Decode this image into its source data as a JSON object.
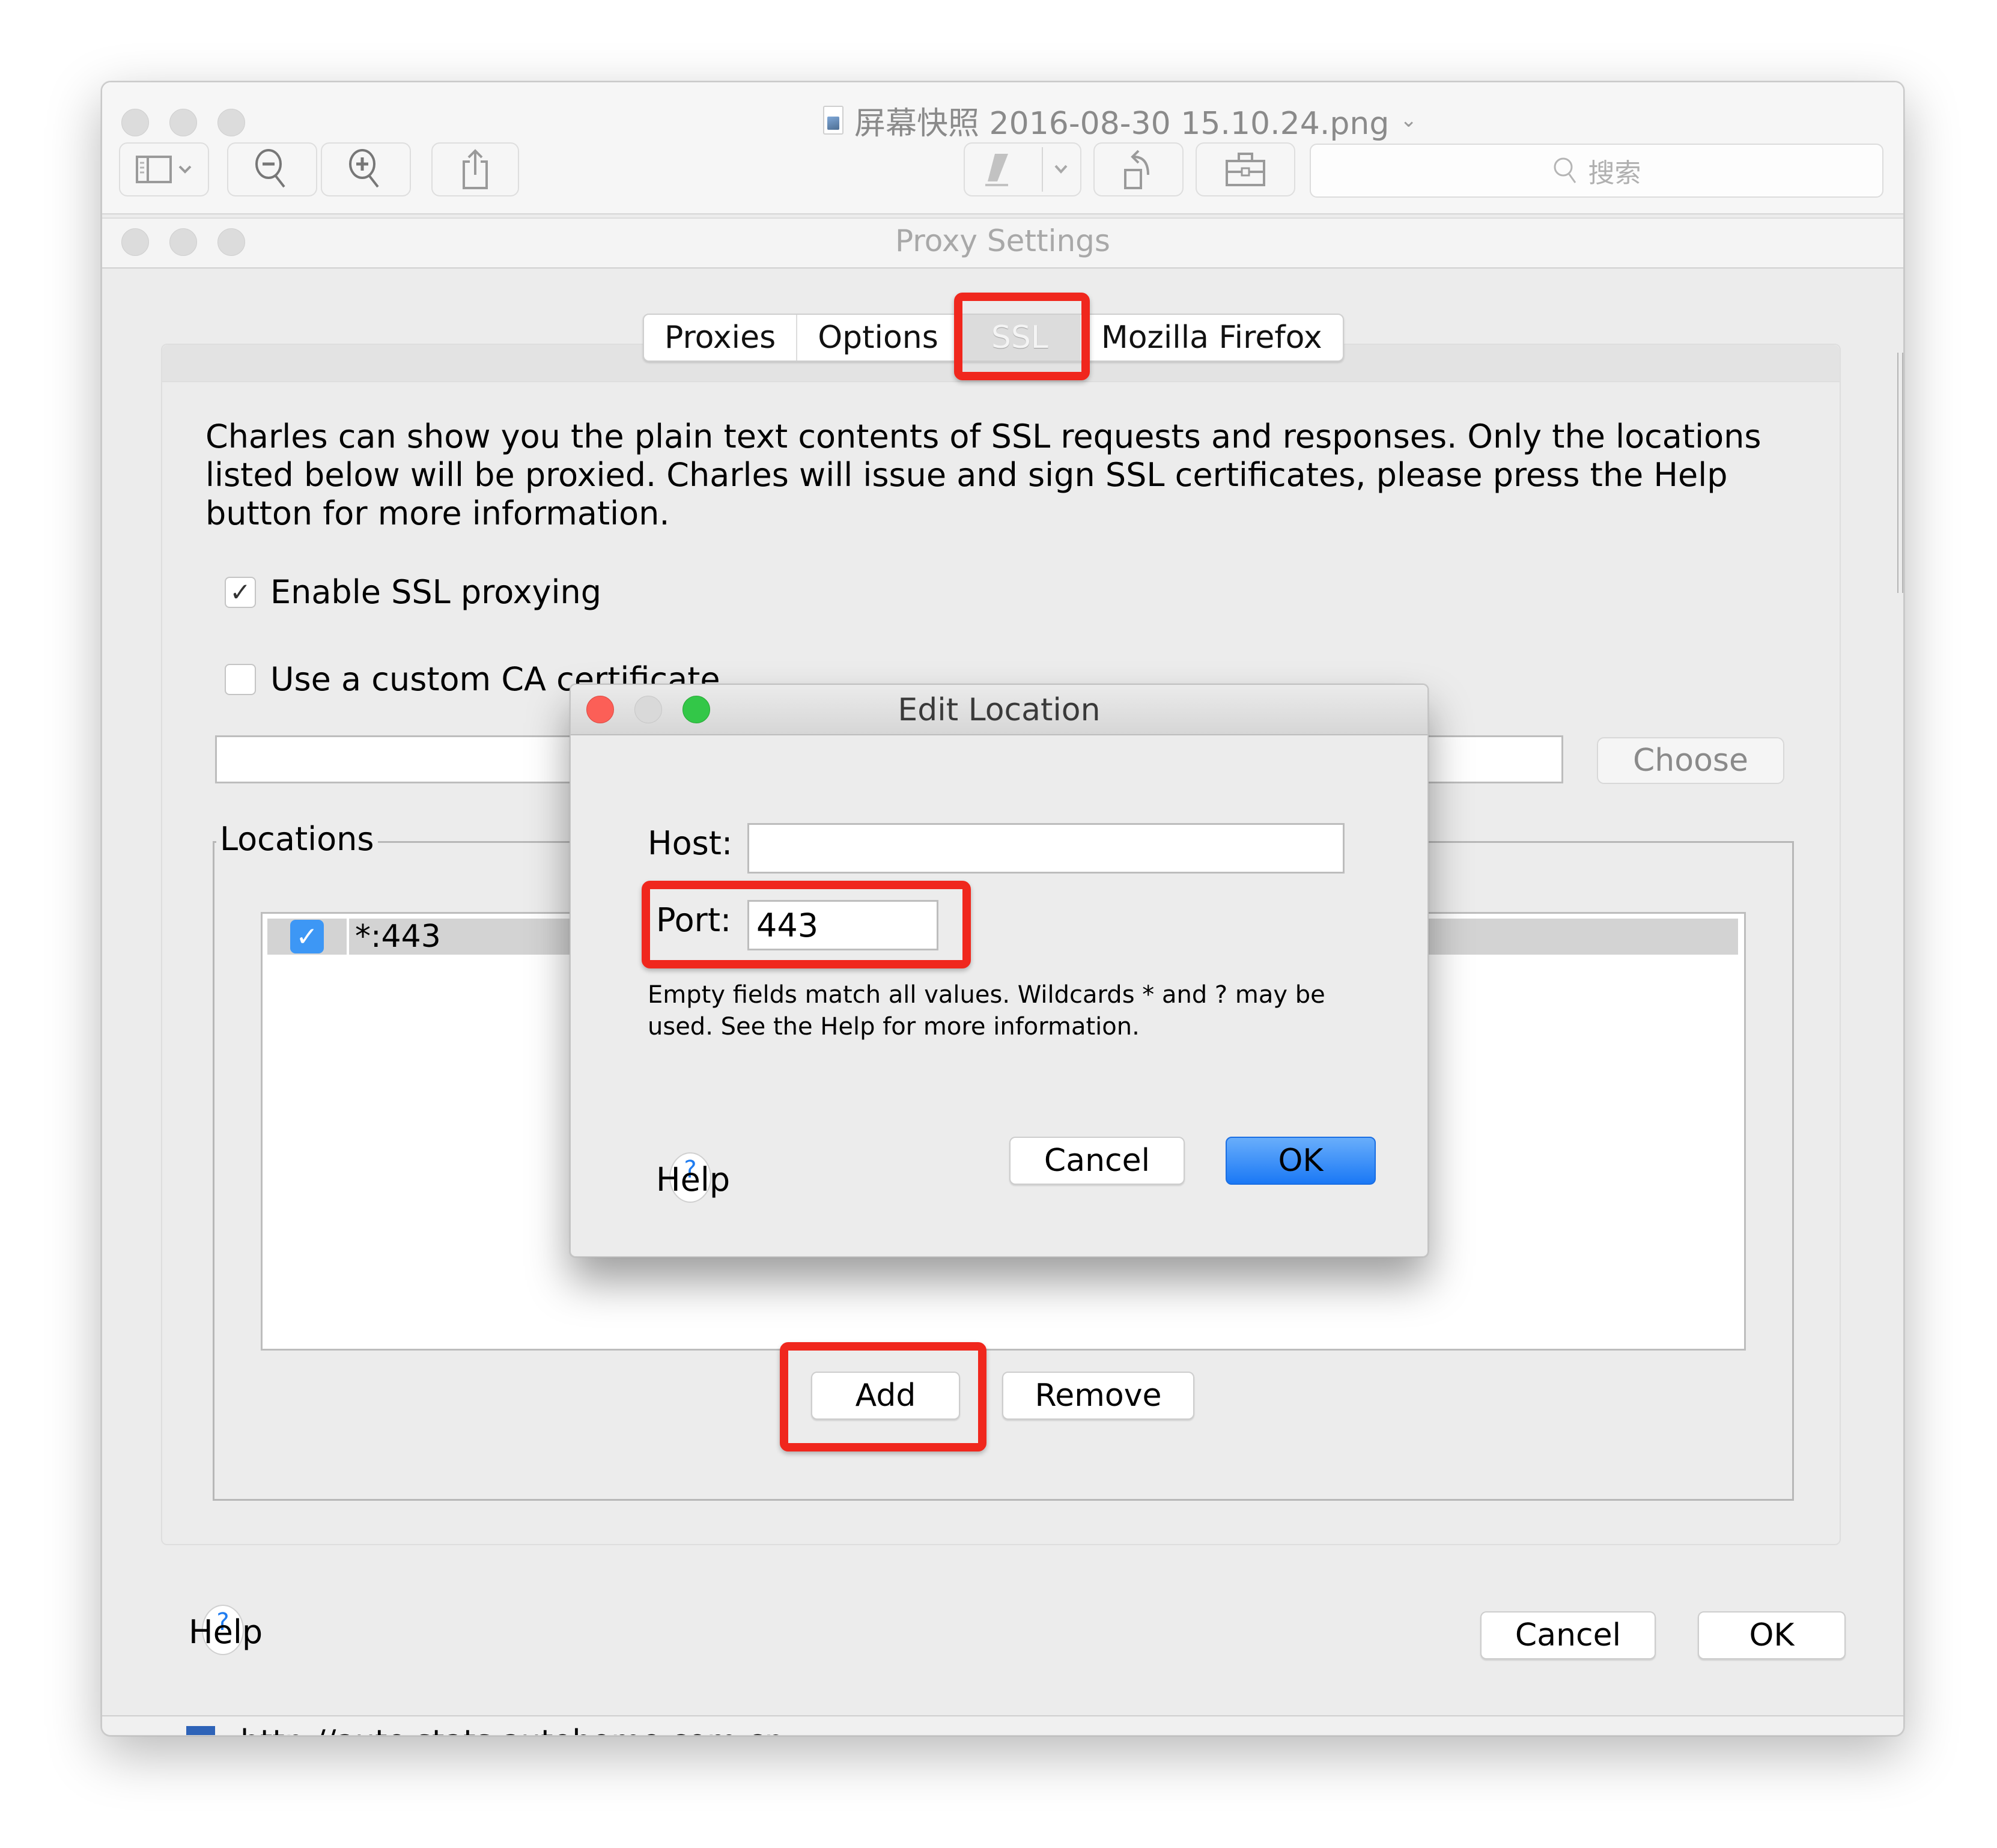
{
  "preview_window": {
    "doc_title": "屏幕快照 2016-08-30 15.10.24.png",
    "toolbar": {
      "sidebar_icon": "sidebar-icon",
      "zoom_out_icon": "zoom-out-icon",
      "zoom_in_icon": "zoom-in-icon",
      "share_icon": "share-icon",
      "markup_icon": "pen-icon",
      "rotate_icon": "rotate-icon",
      "toolbox_icon": "toolbox-icon"
    },
    "search": {
      "placeholder": "搜索"
    },
    "background_row_text": "http://auto.stats.autohome.com.cn"
  },
  "proxy_settings": {
    "title": "Proxy Settings",
    "tabs": [
      {
        "label": "Proxies",
        "selected": false
      },
      {
        "label": "Options",
        "selected": false
      },
      {
        "label": "SSL",
        "selected": true
      },
      {
        "label": "Mozilla Firefox",
        "selected": false
      }
    ],
    "description": "Charles can show you the plain text contents of SSL requests and responses. Only the locations listed below will be proxied. Charles will issue and sign SSL certificates, please press the Help button for more information.",
    "enable_ssl": {
      "label": "Enable SSL proxying",
      "checked": true
    },
    "custom_ca": {
      "label": "Use a custom CA certificate",
      "checked": false,
      "path_value": ""
    },
    "choose_label": "Choose",
    "locations": {
      "legend": "Locations",
      "rows": [
        {
          "enabled": true,
          "location": "*:443"
        }
      ],
      "add_label": "Add",
      "remove_label": "Remove"
    },
    "help_label": "Help",
    "cancel_label": "Cancel",
    "ok_label": "OK"
  },
  "edit_location": {
    "title": "Edit Location",
    "host_label": "Host:",
    "host_value": "",
    "port_label": "Port:",
    "port_value": "443",
    "hint": "Empty fields match all values. Wildcards * and ? may be used. See the Help for more information.",
    "help_label": "Help",
    "cancel_label": "Cancel",
    "ok_label": "OK"
  },
  "colors": {
    "annotation_red": "#f0271d",
    "default_button_blue": "#1a78f5",
    "checkbox_blue": "#3d97f5",
    "traffic_red": "#fc5f57",
    "traffic_green": "#33c748"
  },
  "annotations": [
    {
      "target": "ssl-tab",
      "style": "red-box"
    },
    {
      "target": "port-field",
      "style": "red-box"
    },
    {
      "target": "add-button",
      "style": "red-box"
    }
  ]
}
